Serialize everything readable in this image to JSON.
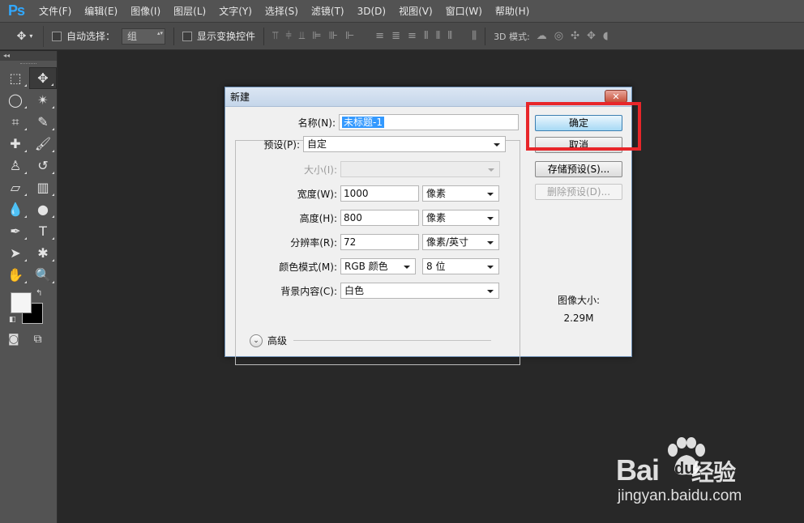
{
  "app": {
    "logo": "Ps",
    "menu": [
      "文件(F)",
      "编辑(E)",
      "图像(I)",
      "图层(L)",
      "文字(Y)",
      "选择(S)",
      "滤镜(T)",
      "3D(D)",
      "视图(V)",
      "窗口(W)",
      "帮助(H)"
    ]
  },
  "options_bar": {
    "move_tool_icon": "move-tool-icon",
    "auto_select_label": "自动选择：",
    "auto_select_value": "组",
    "show_transform_label": "显示变换控件",
    "mode3d_label": "3D 模式:"
  },
  "toolbox": {
    "collapse": "◂◂",
    "tools": [
      {
        "name": "marquee-tool",
        "glyph": "⬚"
      },
      {
        "name": "move-tool",
        "glyph": "✥"
      },
      {
        "name": "lasso-tool",
        "glyph": "◯"
      },
      {
        "name": "magic-wand-tool",
        "glyph": "✴"
      },
      {
        "name": "crop-tool",
        "glyph": "⌗"
      },
      {
        "name": "eyedropper-tool",
        "glyph": "✎"
      },
      {
        "name": "healing-brush-tool",
        "glyph": "✚"
      },
      {
        "name": "brush-tool",
        "glyph": "🖌"
      },
      {
        "name": "clone-stamp-tool",
        "glyph": "♙"
      },
      {
        "name": "history-brush-tool",
        "glyph": "↺"
      },
      {
        "name": "eraser-tool",
        "glyph": "▱"
      },
      {
        "name": "gradient-tool",
        "glyph": "▥"
      },
      {
        "name": "blur-tool",
        "glyph": "💧"
      },
      {
        "name": "dodge-tool",
        "glyph": "●"
      },
      {
        "name": "pen-tool",
        "glyph": "✒"
      },
      {
        "name": "type-tool",
        "glyph": "T"
      },
      {
        "name": "path-selection-tool",
        "glyph": "➤"
      },
      {
        "name": "shape-tool",
        "glyph": "✱"
      },
      {
        "name": "hand-tool",
        "glyph": "✋"
      },
      {
        "name": "zoom-tool",
        "glyph": "🔍"
      }
    ]
  },
  "dialog": {
    "title": "新建",
    "close": "✕",
    "name_label": "名称(N):",
    "name_value": "未标题-1",
    "preset_label": "预设(P):",
    "preset_value": "自定",
    "size_label": "大小(I):",
    "size_value": "",
    "width_label": "宽度(W):",
    "width_value": "1000",
    "width_unit": "像素",
    "height_label": "高度(H):",
    "height_value": "800",
    "height_unit": "像素",
    "resolution_label": "分辨率(R):",
    "resolution_value": "72",
    "resolution_unit": "像素/英寸",
    "color_mode_label": "颜色模式(M):",
    "color_mode_value": "RGB 颜色",
    "bit_depth_value": "8 位",
    "background_label": "背景内容(C):",
    "background_value": "白色",
    "advanced_label": "高级",
    "ok_label": "确定",
    "cancel_label": "取消",
    "save_preset_label": "存储预设(S)...",
    "delete_preset_label": "删除预设(D)...",
    "image_size_label": "图像大小:",
    "image_size_value": "2.29M"
  },
  "watermark": {
    "main": "Bai",
    "du": "du",
    "cn": "经验",
    "sub": "jingyan.baidu.com"
  },
  "colors": {
    "highlight": "#e8262a",
    "selection": "#3399ff"
  }
}
